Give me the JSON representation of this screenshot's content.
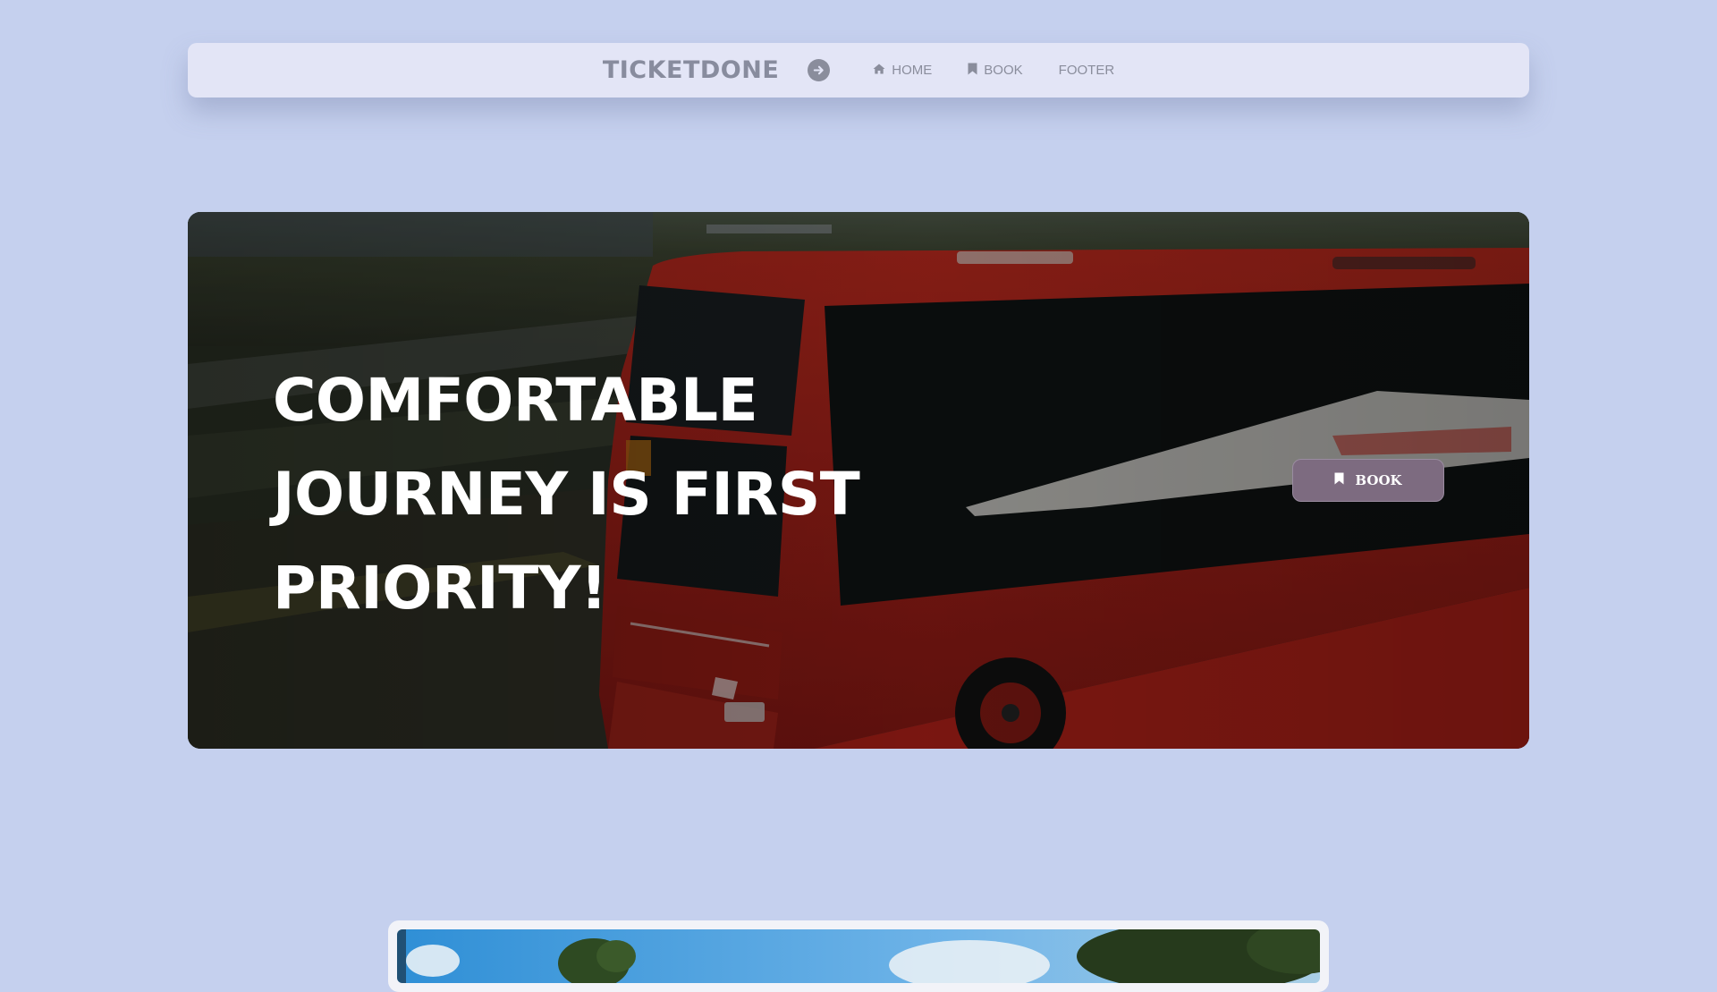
{
  "navbar": {
    "brand": "TICKETDONE",
    "toggle_icon": "arrow-right-circle-icon",
    "links": [
      {
        "label": "HOME",
        "icon": "home-icon"
      },
      {
        "label": "BOOK",
        "icon": "bookmark-icon"
      },
      {
        "label": "FOOTER",
        "icon": null
      }
    ]
  },
  "hero": {
    "title_lines": [
      "COMFORTABLE",
      "JOURNEY IS FIRST",
      "PRIORITY!"
    ],
    "image": "red-coach-bus-photo",
    "book_button": {
      "label": "BOOK",
      "icon": "bookmark-icon"
    }
  },
  "gallery": {
    "image": "trees-sky-photo"
  },
  "colors": {
    "page_background": "#c5d0ee",
    "navbar_background": "#e3e5f6",
    "nav_text": "#8a8d9c",
    "book_button": "#7d6b80",
    "bus_red": "#a8251d"
  }
}
